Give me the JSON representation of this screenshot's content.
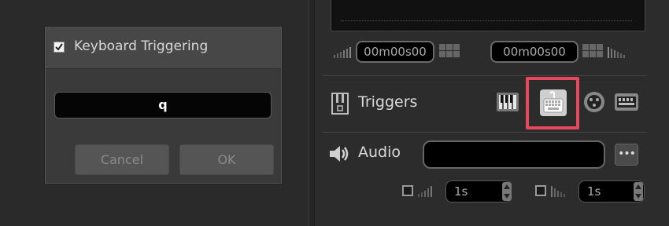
{
  "dialog": {
    "title": "Keyboard Triggering",
    "checkbox_checked": true,
    "key_value": "q",
    "cancel_label": "Cancel",
    "ok_label": "OK"
  },
  "timecodes": {
    "start": "00m00s00",
    "end": "00m00s00"
  },
  "triggers": {
    "label": "Triggers",
    "buttons": [
      "piano-keys-icon",
      "keyboard-icon",
      "dmx-icon",
      "midi-icon"
    ],
    "highlight_color": "#e7485c"
  },
  "audio": {
    "label": "Audio",
    "file_value": "",
    "more_label": "•••",
    "fade_in_value": "1s",
    "fade_out_value": "1s"
  }
}
